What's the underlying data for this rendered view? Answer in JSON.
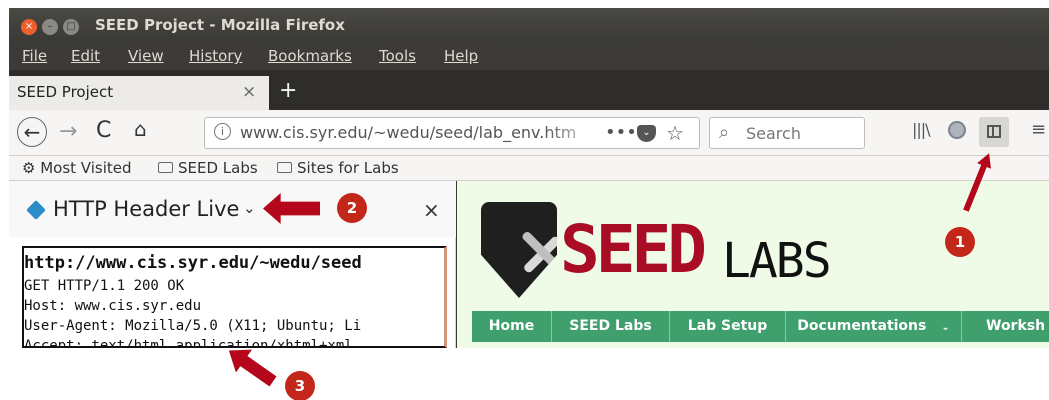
{
  "window": {
    "title": "SEED Project - Mozilla Firefox",
    "controls": {
      "close": "×",
      "minimize": "–",
      "maximize": "□"
    }
  },
  "menubar": [
    "File",
    "Edit",
    "View",
    "History",
    "Bookmarks",
    "Tools",
    "Help"
  ],
  "tab": {
    "title": "SEED Project",
    "close": "×",
    "new_tab": "+"
  },
  "navbar": {
    "back": "←",
    "forward": "→",
    "reload": "C",
    "home": "⌂",
    "url": "www.cis.syr.edu/~wedu/seed/lab_env.htm",
    "page_actions": "•••",
    "search_placeholder": "Search",
    "library": "|||\\",
    "menu": "≡"
  },
  "bookmarks": [
    "Most Visited",
    "SEED Labs",
    "Sites for Labs"
  ],
  "sidebar": {
    "title": "HTTP Header Live",
    "chevron": "⌄",
    "close": "×",
    "http": {
      "request_url": "http://www.cis.syr.edu/~wedu/seed",
      "lines": [
        "GET HTTP/1.1 200 OK",
        "Host: www.cis.syr.edu",
        "User-Agent: Mozilla/5.0 (X11; Ubuntu; Li",
        "Accept: text/html,application/xhtml+xml,"
      ]
    }
  },
  "page": {
    "logo": {
      "seed": "SEED",
      "labs": "LABS"
    },
    "nav": [
      "Home",
      "SEED Labs",
      "Lab Setup",
      "Documentations",
      "Worksh"
    ],
    "dropdown_mark": "⌄"
  },
  "annotations": [
    "1",
    "2",
    "3"
  ],
  "colors": {
    "annotation_red": "#b5071b",
    "seed_red": "#a90d25",
    "nav_green": "#3f9f6d"
  }
}
